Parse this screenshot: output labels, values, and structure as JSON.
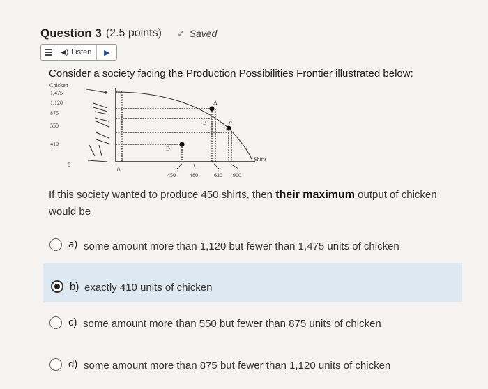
{
  "question": {
    "title": "Question 3",
    "points": "(2.5 points)",
    "saved_label": "Saved",
    "check_icon": "check-icon"
  },
  "listen_bar": {
    "listen_label": "Listen",
    "menu_icon": "hamburger-icon",
    "speaker_icon": "speaker-icon",
    "play_icon": "play-icon"
  },
  "prompt": "Consider a society facing the Production Possibilities Frontier illustrated below:",
  "figure": {
    "y_axis_title": "Chicken",
    "y_ticks": [
      "1,475",
      "1,120",
      "875",
      "550",
      "410"
    ],
    "y_zero": "0",
    "x_zero": "0",
    "x_axis_label": "Shirts",
    "x_ticks": [
      "450",
      "480",
      "630",
      "900"
    ],
    "points": [
      "A",
      "B",
      "C",
      "D"
    ]
  },
  "question_text": {
    "part1": "If this society wanted to produce 450 shirts, then",
    "bold": "their maximum",
    "part2": "output of chicken would be"
  },
  "options": [
    {
      "letter": "a)",
      "text": "some amount more than 1,120 but fewer than 1,475 units of chicken",
      "selected": false
    },
    {
      "letter": "b)",
      "text": "exactly 410 units of chicken",
      "selected": true
    },
    {
      "letter": "c)",
      "text": "some amount more than 550 but fewer than 875 units of chicken",
      "selected": false
    },
    {
      "letter": "d)",
      "text": "some amount more than 875 but fewer than 1,120 units of chicken",
      "selected": false
    }
  ]
}
